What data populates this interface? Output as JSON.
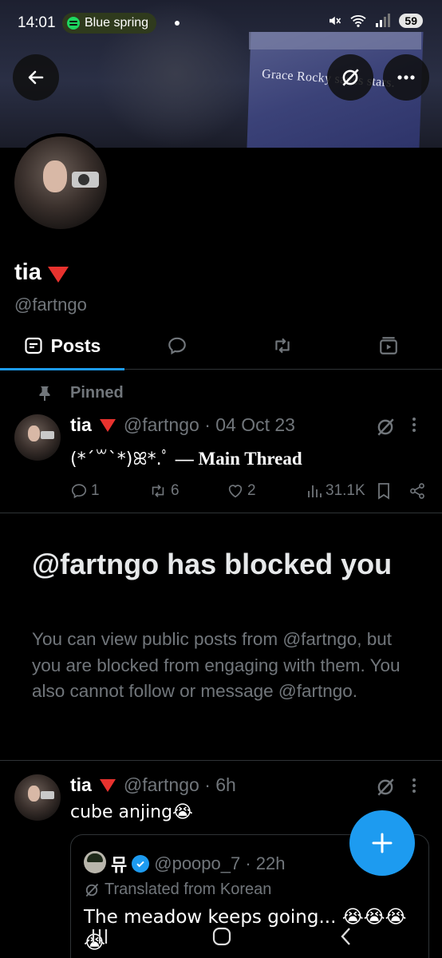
{
  "status_bar": {
    "time": "14:01",
    "now_playing": "Blue spring",
    "battery": "59"
  },
  "banner": {
    "screen_text": "Grace Rocky saves stars."
  },
  "profile": {
    "name": "tia",
    "handle": "@fartngo"
  },
  "tabs": [
    {
      "label": "Posts",
      "active": true,
      "icon": "posts-icon"
    },
    {
      "label": "",
      "icon": "replies-icon"
    },
    {
      "label": "",
      "icon": "reposts-icon"
    },
    {
      "label": "",
      "icon": "media-icon"
    }
  ],
  "pinned_post": {
    "pinned_label": "Pinned",
    "name": "tia",
    "meta": "@fartngo · 04 Oct 23",
    "text": "(*ˊ꒳ˋ*)ꕤ*.ﾟ",
    "text_bold": "— Main Thread",
    "replies": "1",
    "reposts": "6",
    "likes": "2",
    "views": "31.1K"
  },
  "blocked": {
    "title": "@fartngo has blocked you",
    "text": "You can view public posts from @fartngo, but you are blocked from engaging with them. You also cannot follow or message @fartngo."
  },
  "post2": {
    "name": "tia",
    "meta": "@fartngo · 6h",
    "text": "cube anjing😭"
  },
  "quote": {
    "name": "뮤",
    "meta": "@poopo_7 · 22h",
    "translated": "Translated from Korean",
    "text": "The meadow keeps going... 😭😭😭😭"
  },
  "colors": {
    "accent": "#1d9bf0",
    "muted": "#71767b",
    "divider": "#2f3336",
    "flag_red": "#e8322e"
  }
}
